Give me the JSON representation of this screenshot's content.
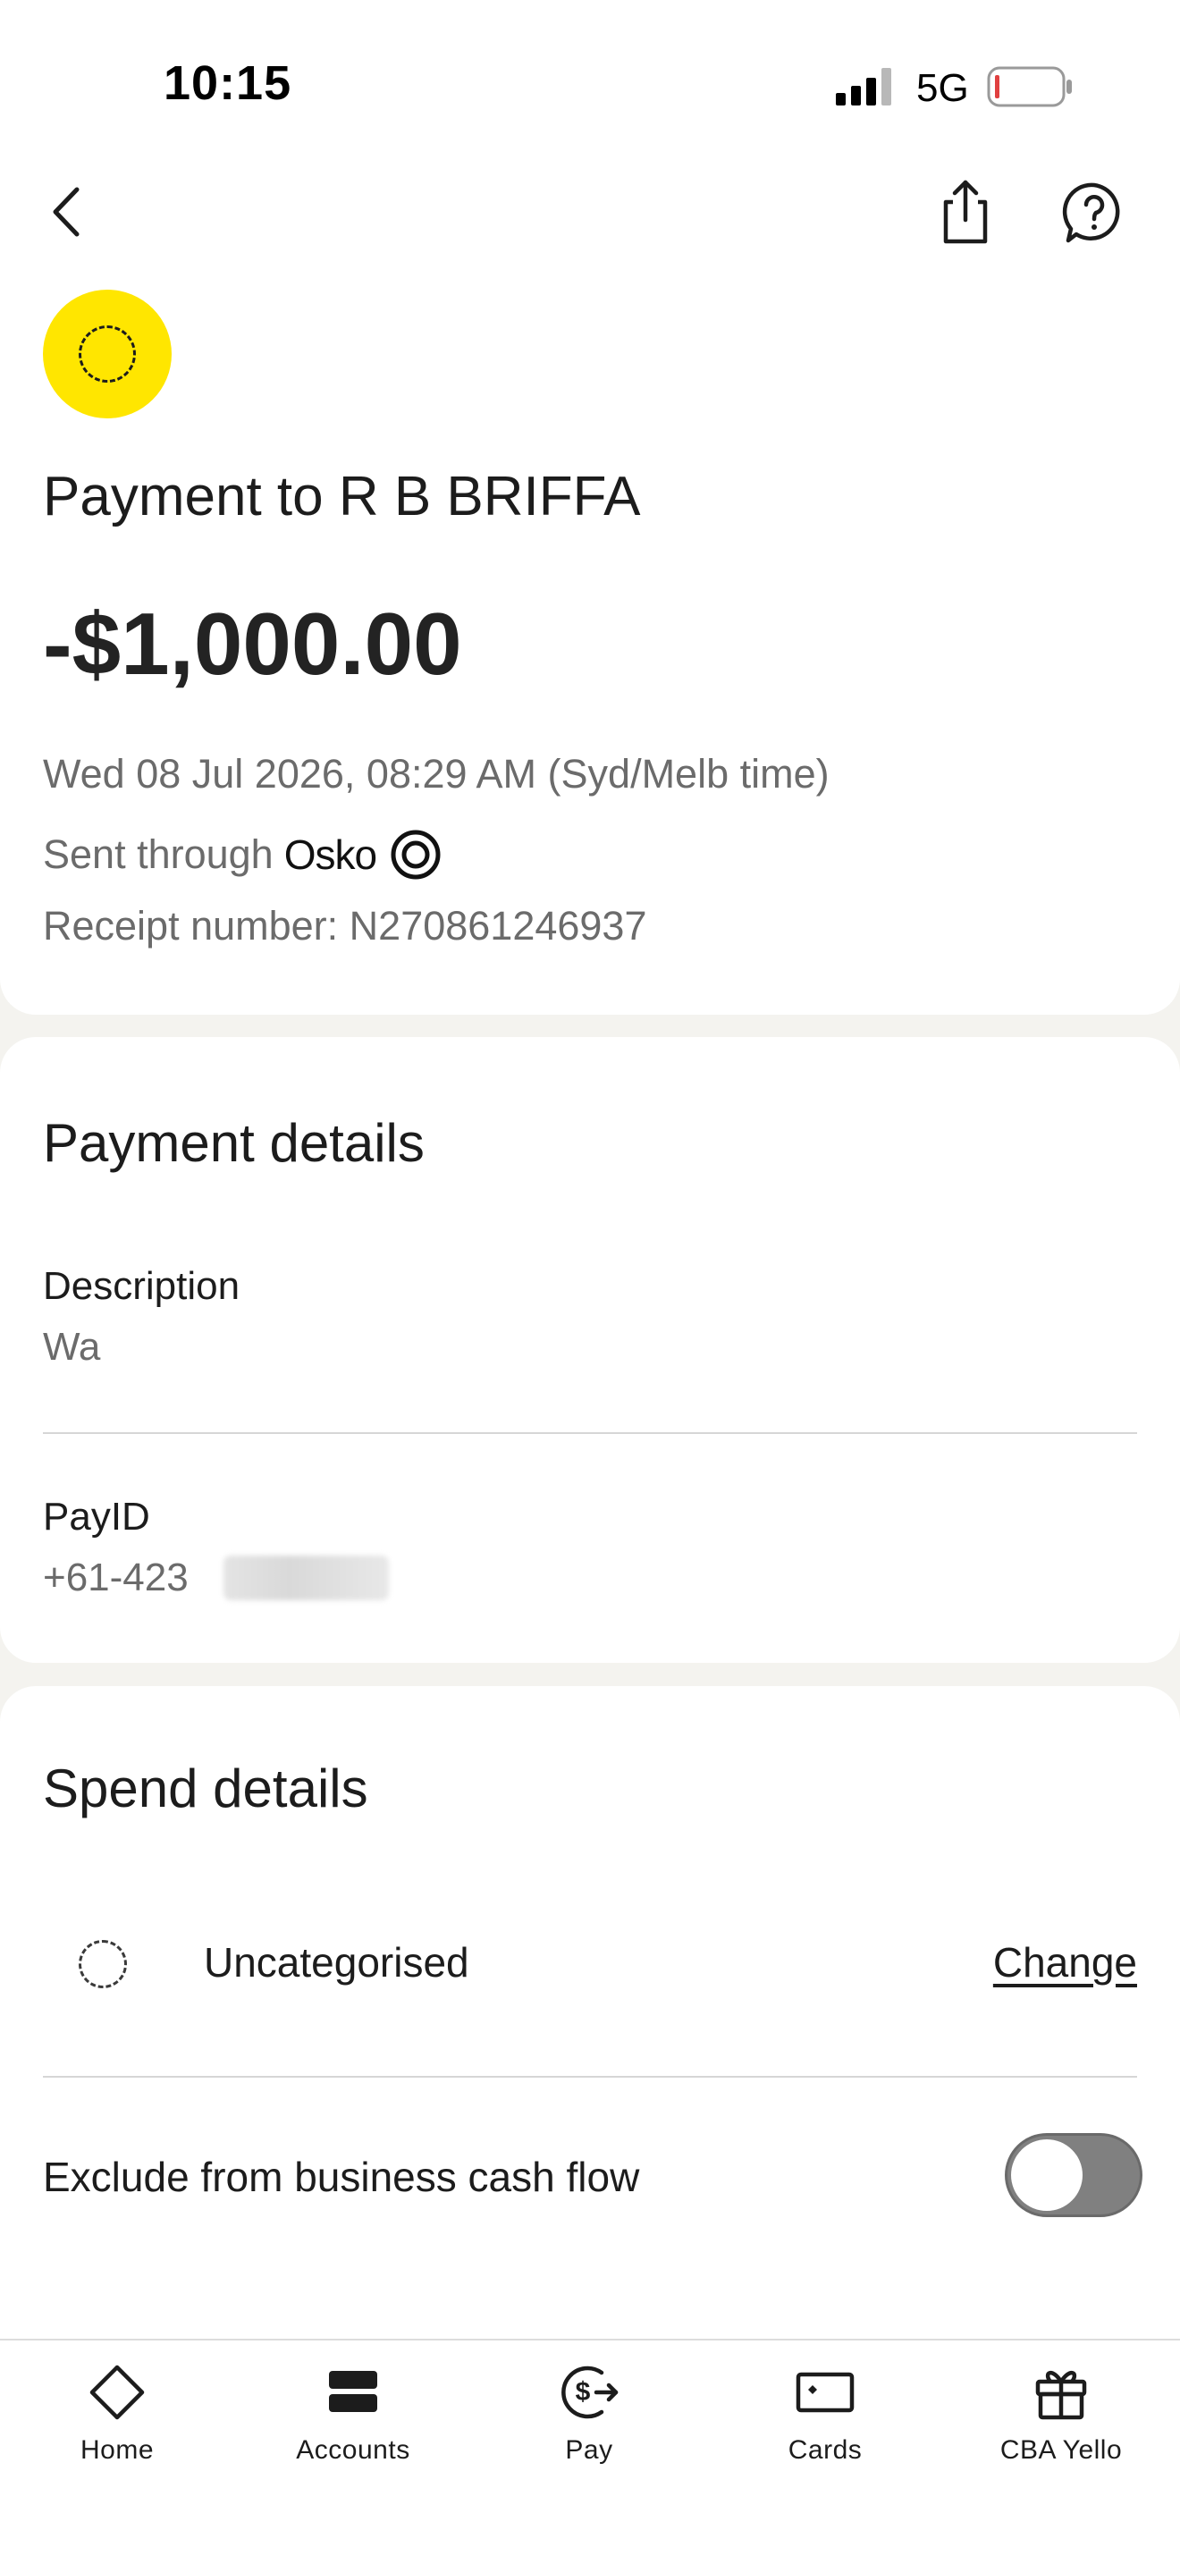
{
  "status_bar": {
    "time": "10:15",
    "network": "5G",
    "battery_color": "#e04040"
  },
  "header": {
    "back_icon": "chevron-left-icon",
    "share_icon": "share-icon",
    "help_icon": "help-bubble-icon"
  },
  "transaction": {
    "avatar_color": "#ffe600",
    "title": "Payment to R B BRIFFA",
    "amount": "-$1,000.00",
    "datetime": "Wed 08 Jul 2026, 08:29 AM (Syd/Melb time)",
    "sent_through_label": "Sent through",
    "network_name": "Osko",
    "receipt": "Receipt number: N270861246937"
  },
  "payment_details": {
    "title": "Payment details",
    "description_label": "Description",
    "description_value": "Wa",
    "payid_label": "PayID",
    "payid_value": "+61-423"
  },
  "spend_details": {
    "title": "Spend details",
    "category": "Uncategorised",
    "change_label": "Change",
    "exclude_label": "Exclude from business cash flow",
    "exclude_enabled": false
  },
  "bottom_nav": {
    "items": [
      {
        "label": "Home",
        "icon": "diamond-icon"
      },
      {
        "label": "Accounts",
        "icon": "accounts-icon"
      },
      {
        "label": "Pay",
        "icon": "pay-icon"
      },
      {
        "label": "Cards",
        "icon": "card-icon"
      },
      {
        "label": "CBA Yello",
        "icon": "gift-icon"
      }
    ]
  }
}
